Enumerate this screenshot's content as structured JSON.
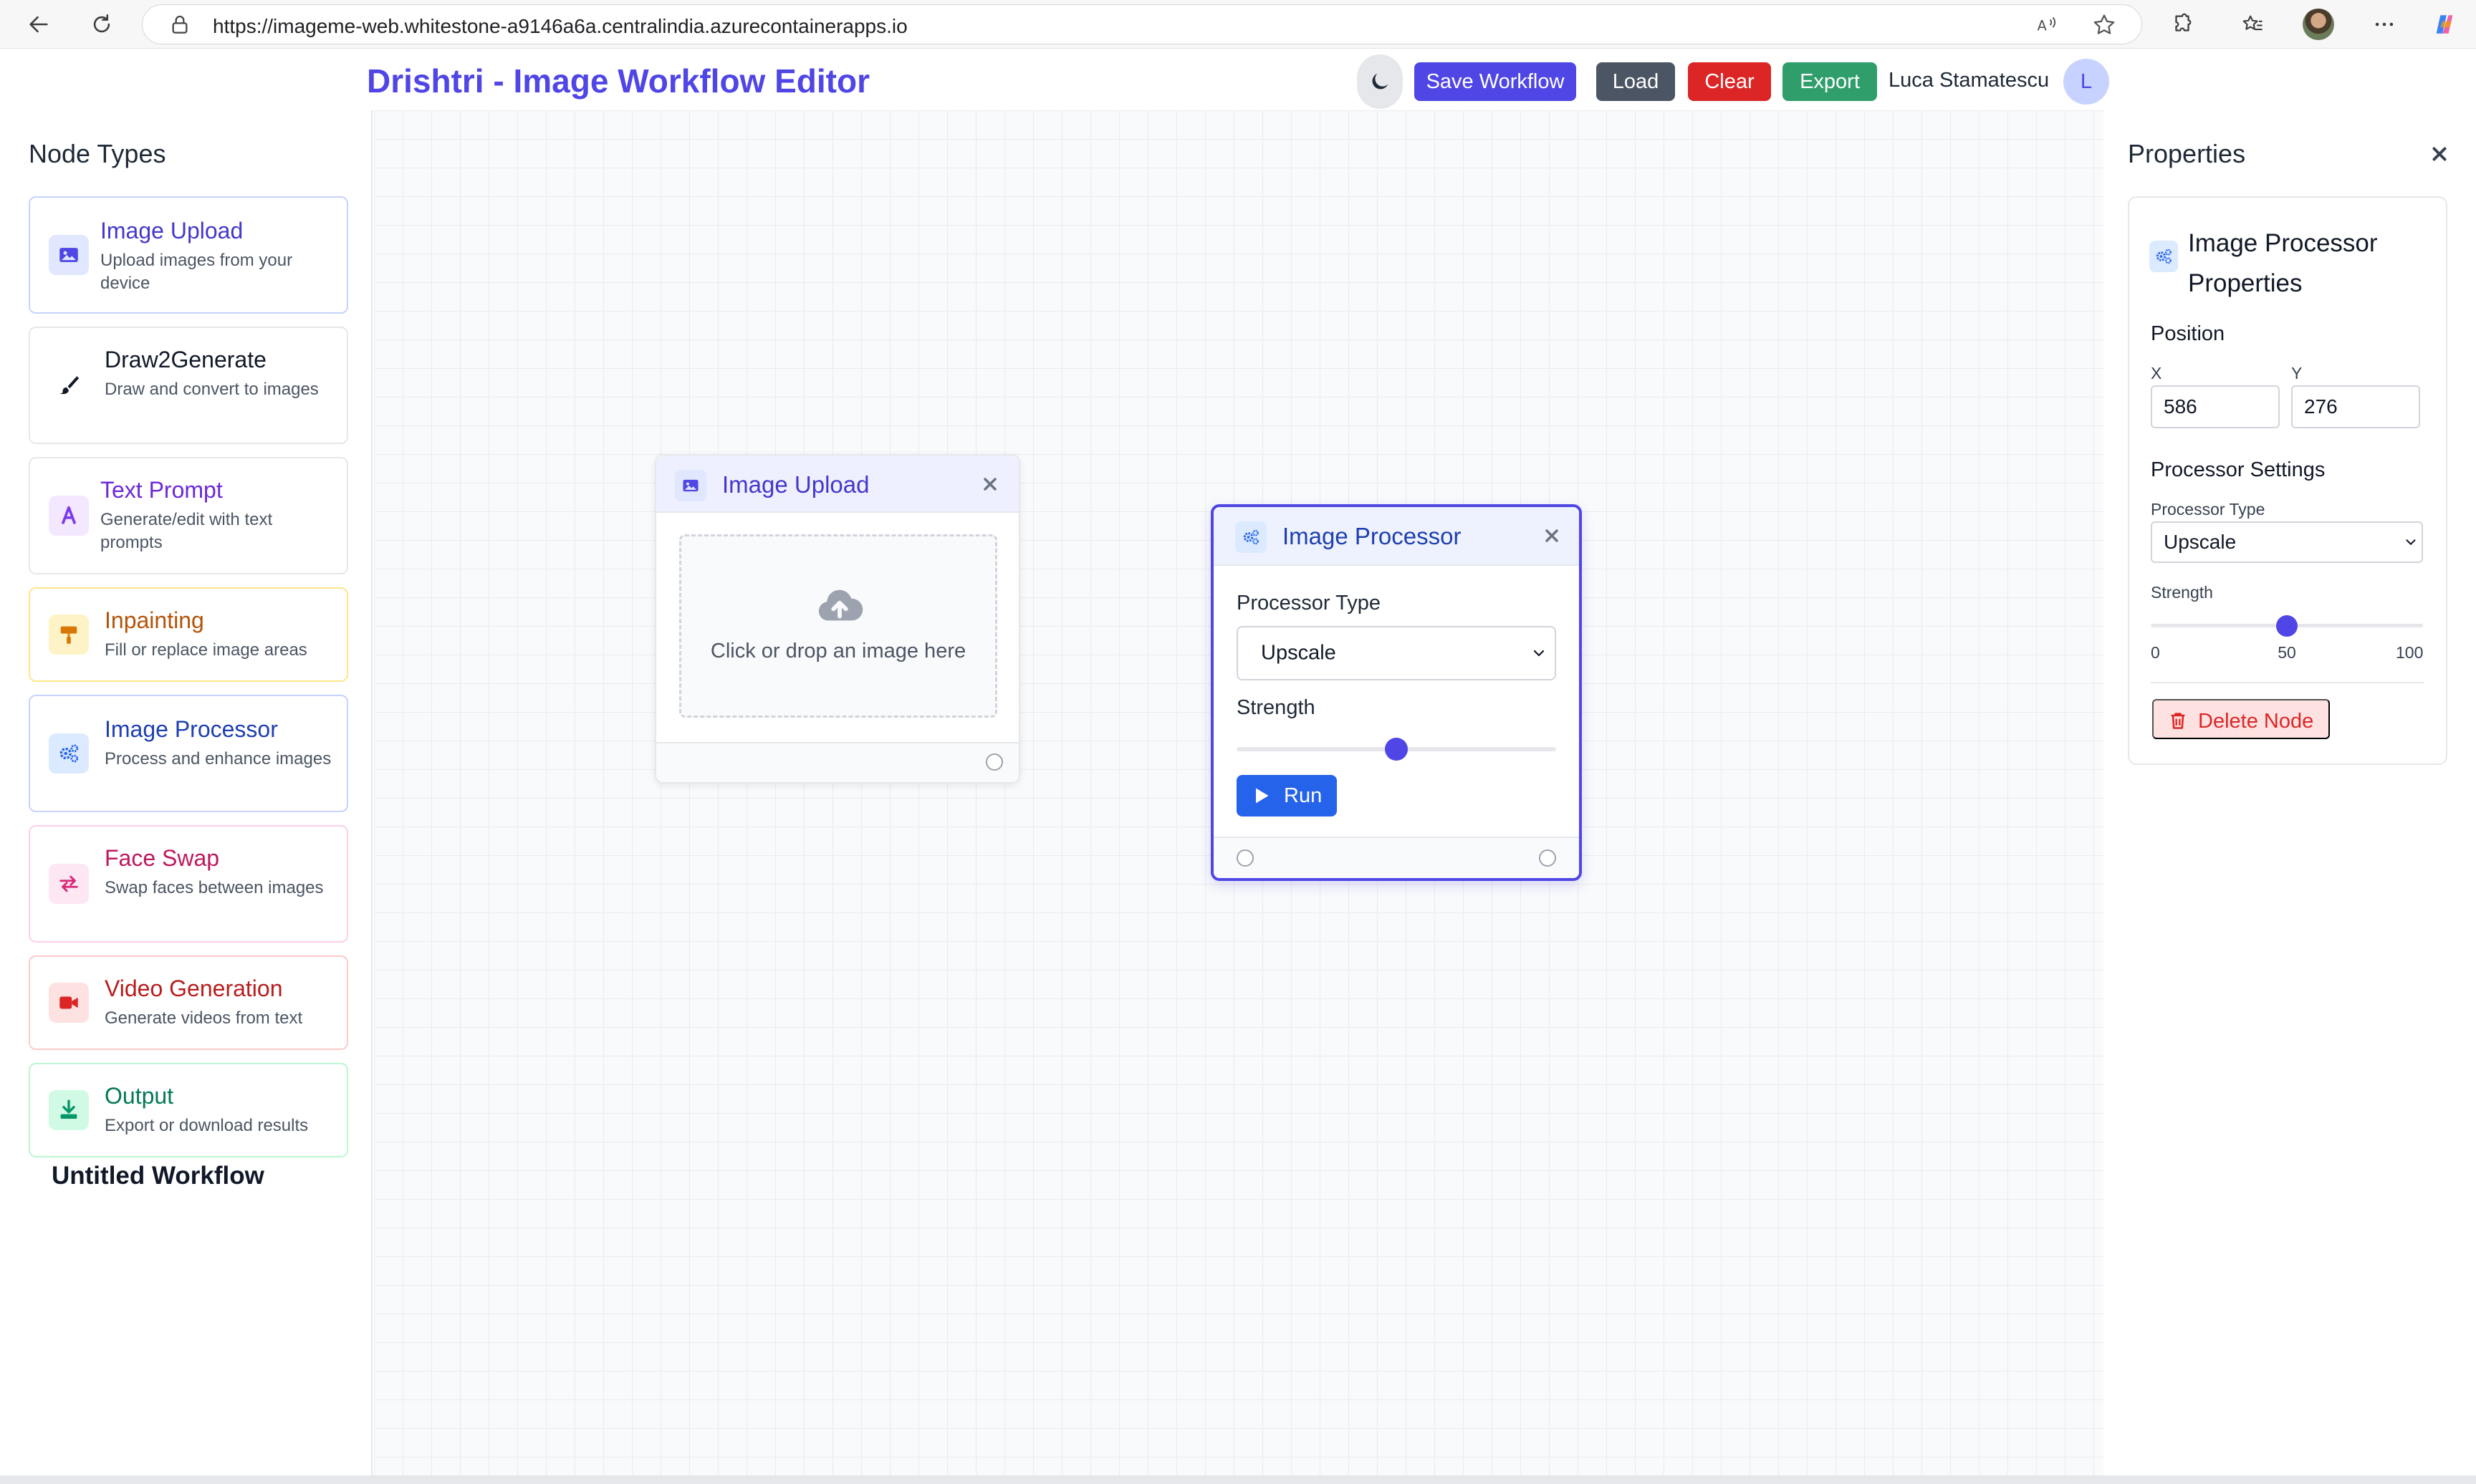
{
  "browser": {
    "url": "https://imageme-web.whitestone-a9146a6a.centralindia.azurecontainerapps.io"
  },
  "header": {
    "title": "Drishtri - Image Workflow Editor",
    "buttons": {
      "save": "Save Workflow",
      "load": "Load",
      "clear": "Clear",
      "export": "Export"
    },
    "user_name": "Luca Stamatescu",
    "user_initial": "L"
  },
  "sidebar": {
    "title": "Node Types",
    "items": [
      {
        "title": "Image Upload",
        "desc": "Upload images from your device",
        "icon": "image-icon",
        "color": "#4f46e5"
      },
      {
        "title": "Draw2Generate",
        "desc": "Draw and convert to images",
        "icon": "paintbrush-icon",
        "color": "#111827"
      },
      {
        "title": "Text Prompt",
        "desc": "Generate/edit with text prompts",
        "icon": "font-icon",
        "color": "#6d28d9"
      },
      {
        "title": "Inpainting",
        "desc": "Fill or replace image areas",
        "icon": "paint-roller-icon",
        "color": "#b45309"
      },
      {
        "title": "Image Processor",
        "desc": "Process and enhance images",
        "icon": "cogs-icon",
        "color": "#1e40af"
      },
      {
        "title": "Face Swap",
        "desc": "Swap faces between images",
        "icon": "exchange-icon",
        "color": "#be185d"
      },
      {
        "title": "Video Generation",
        "desc": "Generate videos from text",
        "icon": "video-icon",
        "color": "#b91c1c"
      },
      {
        "title": "Output",
        "desc": "Export or download results",
        "icon": "download-icon",
        "color": "#047857"
      }
    ],
    "workflow_name": "Untitled Workflow"
  },
  "canvas": {
    "upload_node": {
      "title": "Image Upload",
      "dropzone_text": "Click or drop an image here"
    },
    "processor_node": {
      "title": "Image Processor",
      "processor_type_label": "Processor Type",
      "processor_type_value": "Upscale",
      "strength_label": "Strength",
      "strength_value": 50,
      "run_label": "Run"
    }
  },
  "properties": {
    "title": "Properties",
    "node_title": "Image Processor Properties",
    "position_label": "Position",
    "x_label": "X",
    "y_label": "Y",
    "x_value": "586",
    "y_value": "276",
    "settings_label": "Processor Settings",
    "processor_type_label": "Processor Type",
    "processor_type_value": "Upscale",
    "strength_label": "Strength",
    "strength_value": 50,
    "strength_min": "0",
    "strength_mid": "50",
    "strength_max": "100",
    "delete_label": "Delete Node"
  },
  "colors": {
    "accent": "#4f46e5",
    "save": "#4f46e5",
    "load": "#4b5563",
    "clear": "#dc2626",
    "export": "#2f9e6b",
    "run": "#2563eb"
  }
}
